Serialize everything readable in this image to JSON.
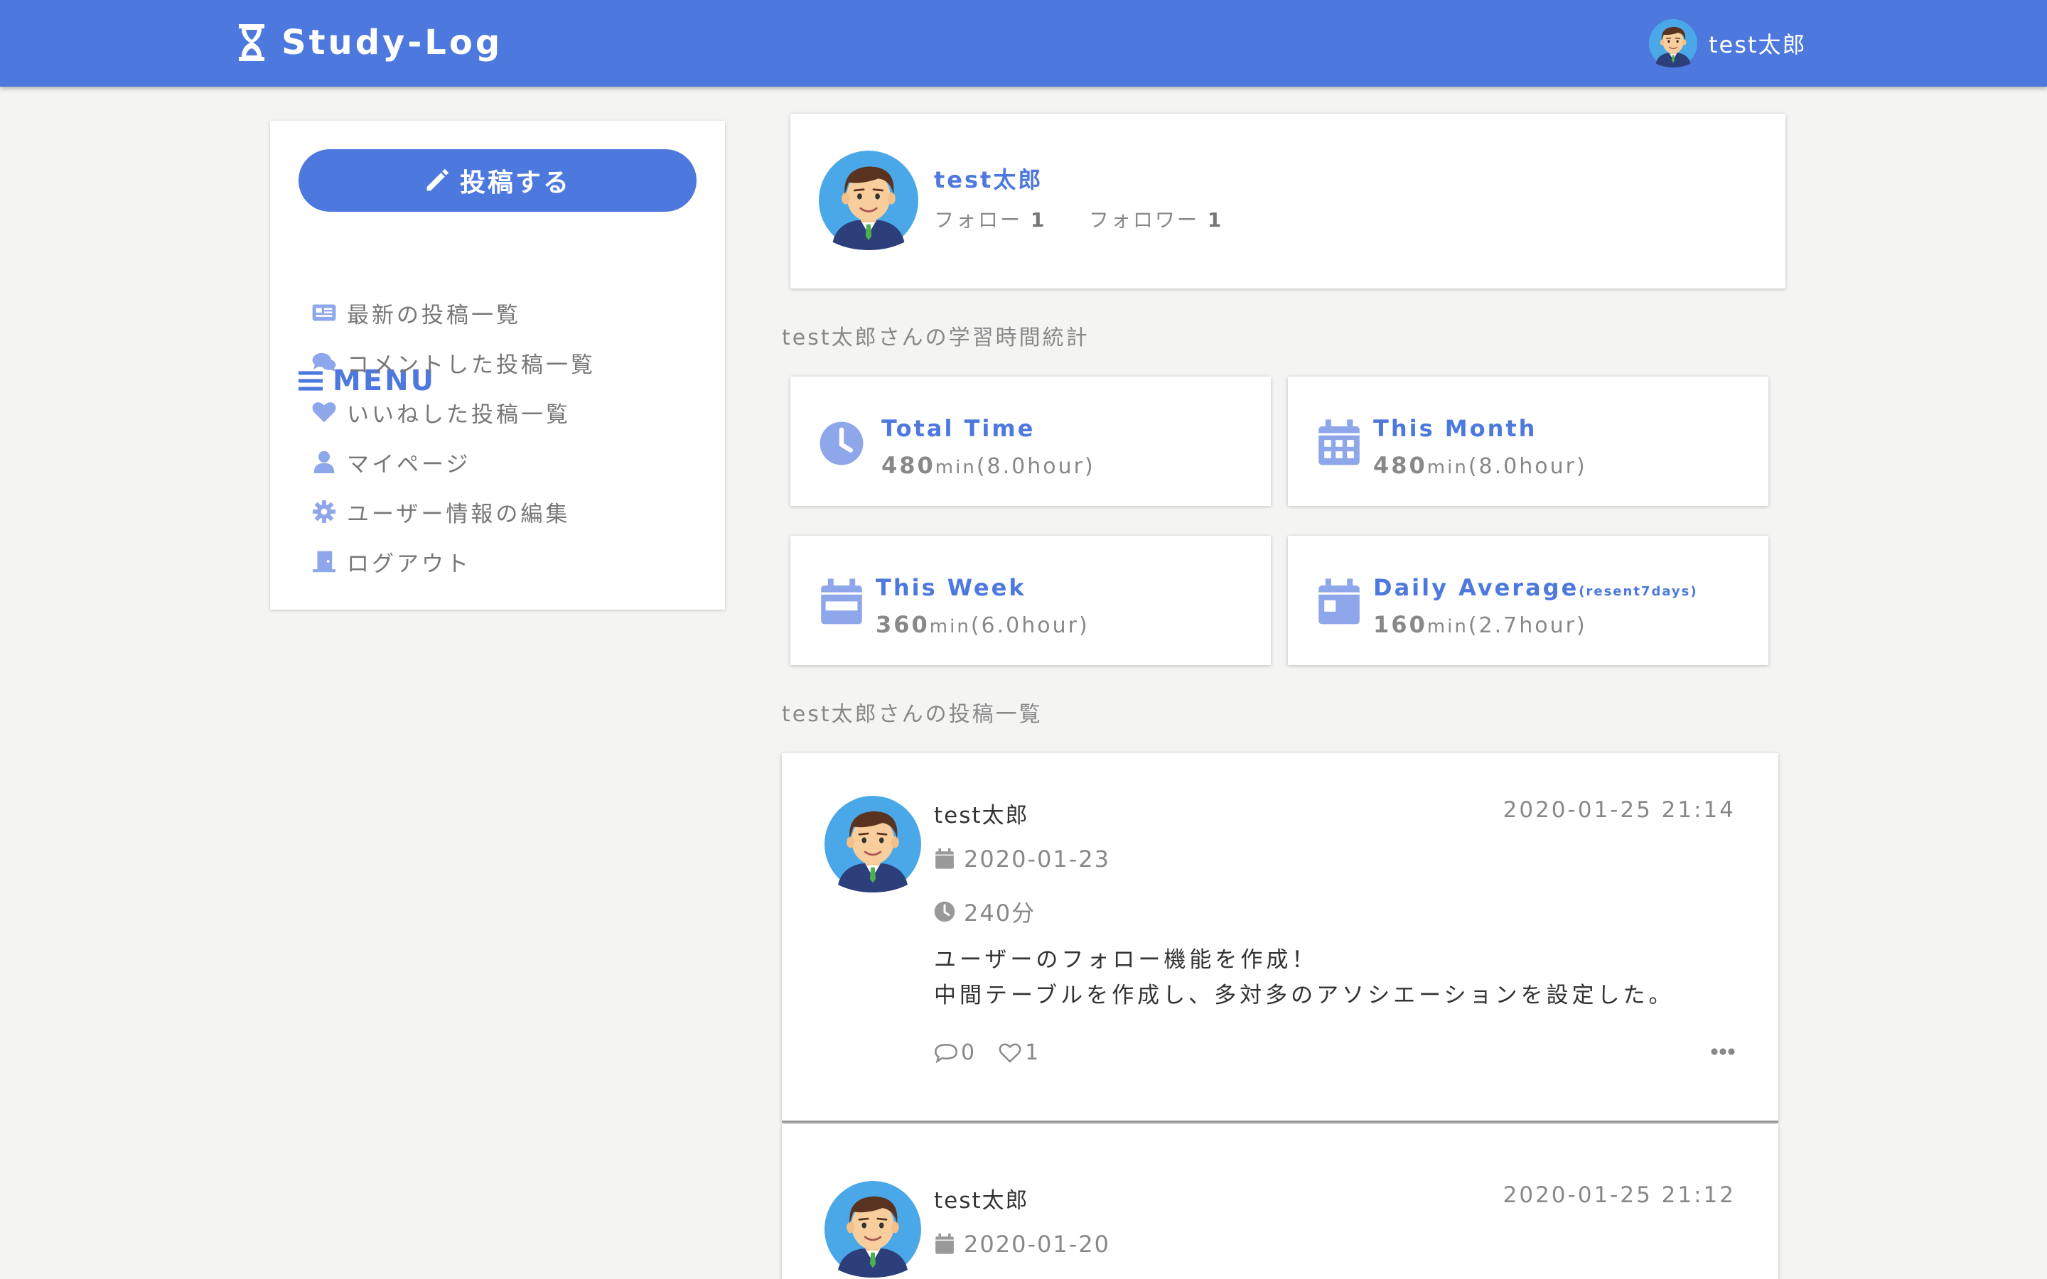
{
  "header": {
    "brand": "Study-Log",
    "user_name": "test太郎"
  },
  "sidebar": {
    "post_button": "投稿する",
    "menu_title": "MENU",
    "items": [
      {
        "label": "最新の投稿一覧",
        "icon": "newspaper-icon"
      },
      {
        "label": "コメントした投稿一覧",
        "icon": "comments-icon"
      },
      {
        "label": "いいねした投稿一覧",
        "icon": "heart-icon"
      },
      {
        "label": "マイページ",
        "icon": "user-icon"
      },
      {
        "label": "ユーザー情報の編集",
        "icon": "gear-icon"
      },
      {
        "label": "ログアウト",
        "icon": "door-icon"
      }
    ]
  },
  "profile": {
    "name": "test太郎",
    "follow_label": "フォロー",
    "follow_count": "1",
    "follower_label": "フォロワー",
    "follower_count": "1"
  },
  "stats_title": "test太郎さんの学習時間統計",
  "stats": [
    {
      "label": "Total Time",
      "minutes": "480",
      "unit": "min",
      "hours": "(8.0hour)",
      "icon": "clock-icon"
    },
    {
      "label": "This Month",
      "minutes": "480",
      "unit": "min",
      "hours": "(8.0hour)",
      "icon": "calendar-month-icon"
    },
    {
      "label": "This Week",
      "minutes": "360",
      "unit": "min",
      "hours": "(6.0hour)",
      "icon": "calendar-week-icon"
    },
    {
      "label": "Daily Average",
      "label_note": "(resent7days)",
      "minutes": "160",
      "unit": "min",
      "hours": "(2.7hour)",
      "icon": "calendar-day-icon"
    }
  ],
  "posts_title": "test太郎さんの投稿一覧",
  "posts": [
    {
      "user": "test太郎",
      "timestamp": "2020-01-25 21:14",
      "study_date": "2020-01-23",
      "duration": "240分",
      "body_line1": "ユーザーのフォロー機能を作成！",
      "body_line2": "中間テーブルを作成し、多対多のアソシエーションを設定した。",
      "comments": "0",
      "likes": "1"
    },
    {
      "user": "test太郎",
      "timestamp": "2020-01-25 21:12",
      "study_date": "2020-01-20"
    }
  ],
  "colors": {
    "accent": "#4d78de",
    "background": "#f4f4f3",
    "icon_light": "#8ea6ea"
  }
}
